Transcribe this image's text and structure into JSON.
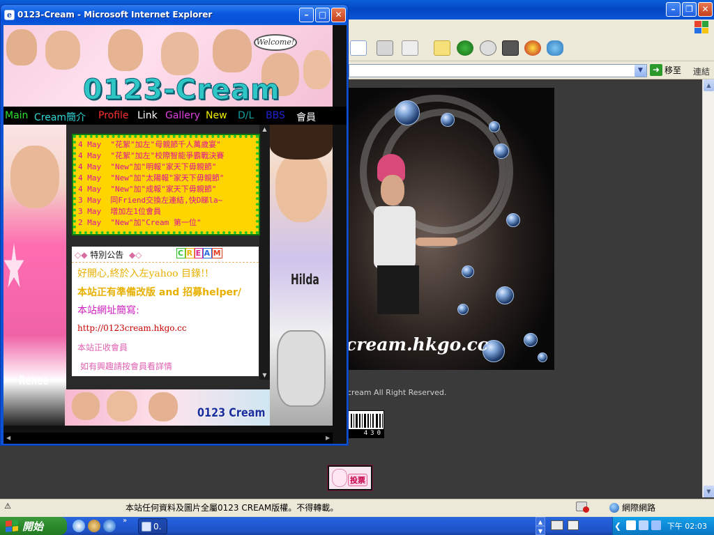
{
  "background_window": {
    "address": {
      "go_label": "移至",
      "links_label": "連結"
    },
    "photo_caption": "cream.hkgo.cc",
    "copyright": "cream All Right Reserved.",
    "counter_digits": "430",
    "vote_label": "投票",
    "status": {
      "text": "本站任何資料及圖片全屬0123 CREAM版權。不得轉載。",
      "zone": "網際網路"
    }
  },
  "popup": {
    "title": "0123-Cream - Microsoft Internet Explorer",
    "banner": {
      "logo": "0123-Cream",
      "welcome": "Welcome!"
    },
    "nav": [
      {
        "label": "Main",
        "color": "#2fe02f"
      },
      {
        "label": "Cream簡介",
        "color": "#2fd6d6"
      },
      {
        "label": "Profile",
        "color": "#ff3030"
      },
      {
        "label": "Link",
        "color": "#ffffff"
      },
      {
        "label": "Gallery",
        "color": "#e040e0"
      },
      {
        "label": "New",
        "color": "#f0f000"
      },
      {
        "label": "D/L",
        "color": "#10a0a0"
      },
      {
        "label": "BBS",
        "color": "#2020d0"
      },
      {
        "label": "會員",
        "color": "#ffffff"
      }
    ],
    "news": [
      {
        "date": "4  May",
        "text": "\"花絮\"加左\"母親節千人萬歲宴\""
      },
      {
        "date": "4  May",
        "text": "\"花絮\"加左\"校際智能爭霸戰決賽"
      },
      {
        "date": "4  May",
        "text": "\"New\"加\"明報\"家天下毋親節\""
      },
      {
        "date": "4  May",
        "text": "\"New\"加\"太陽報\"家天下毋親節\""
      },
      {
        "date": "4  May",
        "text": "\"New\"加\"成報\"家天下毋親節\""
      },
      {
        "date": "3  May",
        "text": "同Friend交換左連結,快D睇la~"
      },
      {
        "date": "3  May",
        "text": "增加左1位會員"
      },
      {
        "date": "2  May",
        "text": "\"New\"加\"Cream 第一位\""
      }
    ],
    "notice": {
      "header": "特別公告",
      "cream_label": "CREAM",
      "lines": [
        {
          "text": "好開心,終於入左yahoo 目錄!!",
          "color": "#e8b000"
        },
        {
          "text": "本站正有準備改版 and 招募helper/",
          "color": "#e8b000"
        },
        {
          "text": "本站網址簡寫:",
          "color": "#d020c0"
        },
        {
          "text": "http://0123cream.hkgo.cc",
          "color": "#c80000"
        },
        {
          "text": "本站正收會員",
          "color": "#e060b0"
        },
        {
          "text": "如有興趣請按會員看詳情",
          "color": "#e060b0"
        }
      ]
    },
    "photo_labels": {
      "left": "Renee",
      "right": "Hilda"
    },
    "bottom_logo": "0123 Cream"
  },
  "taskbar": {
    "start_label": "開始",
    "task_label": "0.",
    "clock": "下午 02:03"
  }
}
